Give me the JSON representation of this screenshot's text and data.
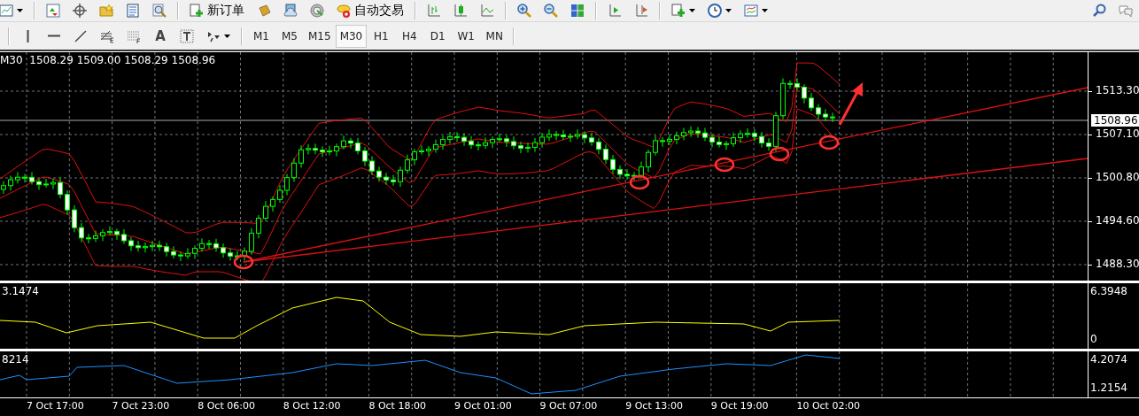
{
  "toolbar": {
    "buttons": [
      {
        "label": "新订单"
      },
      {
        "label": "自动交易"
      }
    ]
  },
  "timeframes": [
    {
      "label": "M1",
      "selected": false
    },
    {
      "label": "M5",
      "selected": false
    },
    {
      "label": "M15",
      "selected": false
    },
    {
      "label": "M30",
      "selected": true
    },
    {
      "label": "H1",
      "selected": false
    },
    {
      "label": "H4",
      "selected": false
    },
    {
      "label": "D1",
      "selected": false
    },
    {
      "label": "W1",
      "selected": false
    },
    {
      "label": "MN",
      "selected": false
    }
  ],
  "drawing_tools": [
    {
      "label": "A"
    }
  ],
  "chart": {
    "header": "M30  1508.29 1509.00 1508.29 1508.96",
    "price_axis": [
      "1513.30",
      "1507.10",
      "1500.80",
      "1494.60",
      "1488.30"
    ],
    "current_price": "1508.96",
    "indicators": [
      {
        "label": "3.1474",
        "axis": [
          "6.3948",
          "0"
        ]
      },
      {
        "label": "8214",
        "axis": [
          "4.2074",
          "1.2154"
        ]
      }
    ],
    "time_axis": [
      "7 Oct 17:00",
      "7 Oct 23:00",
      "8 Oct 06:00",
      "8 Oct 12:00",
      "8 Oct 18:00",
      "9 Oct 01:00",
      "9 Oct 07:00",
      "9 Oct 13:00",
      "9 Oct 19:00",
      "10 Oct 02:00"
    ]
  }
}
